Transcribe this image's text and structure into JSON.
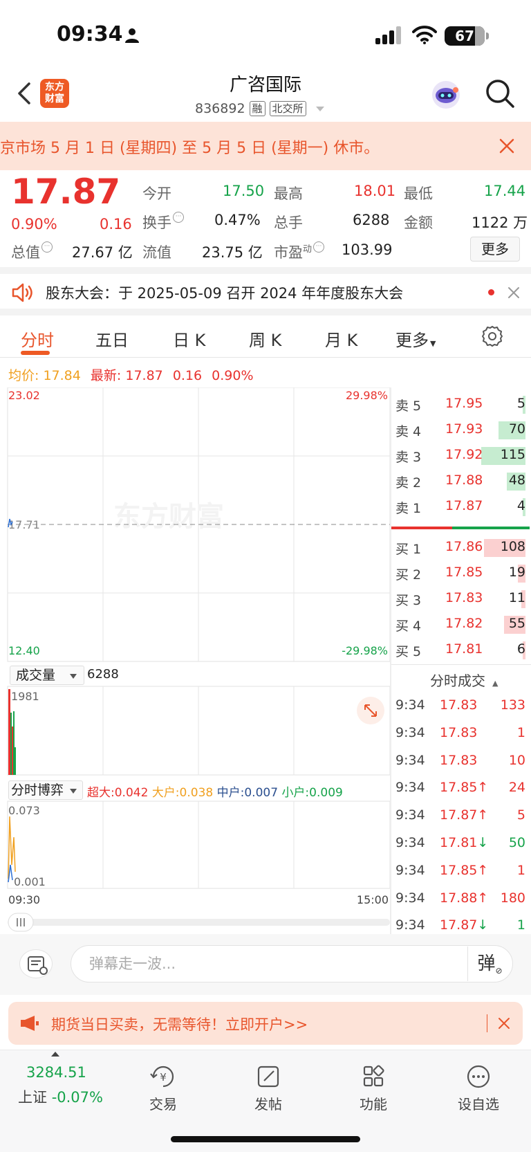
{
  "status_bar": {
    "time": "09:34",
    "battery": "67"
  },
  "header": {
    "title": "广咨国际",
    "code": "836892",
    "tag_margin": "融",
    "tag_exchange": "北交所",
    "logo_line1": "东方",
    "logo_line2": "财富"
  },
  "notice": {
    "text": "京市场 5 月 1 日 (星期四) 至 5 月 5 日 (星期一) 休市。"
  },
  "quote": {
    "price": "17.87",
    "change_pct": "0.90%",
    "change": "0.16",
    "open_label": "今开",
    "open": "17.50",
    "high_label": "最高",
    "high": "18.01",
    "low_label": "最低",
    "low": "17.44",
    "turnover_label": "换手",
    "turnover": "0.47%",
    "volume_label": "总手",
    "volume": "6288",
    "amount_label": "金额",
    "amount": "1122 万",
    "mktcap_label": "总值",
    "mktcap": "27.67 亿",
    "float_label": "流值",
    "float": "23.75 亿",
    "pe_label": "市盈",
    "pe_sup": "动",
    "pe": "103.99",
    "more": "更多"
  },
  "meeting": {
    "text": "股东大会：于 2025-05-09 召开 2024 年年度股东大会"
  },
  "tabs": [
    "分时",
    "五日",
    "日 K",
    "周 K",
    "月 K",
    "更多"
  ],
  "intraday": {
    "avg_label": "均价:",
    "avg": "17.84",
    "latest_label": "最新:",
    "latest": "17.87",
    "chg": "0.16",
    "pct": "0.90%",
    "ymax": "23.02",
    "ymin": "12.40",
    "pmax": "29.98%",
    "pmin": "-29.98%",
    "pre_close": "17.71",
    "watermark": "东方财富"
  },
  "orderbook": {
    "asks": [
      {
        "label": "卖 5",
        "price": "17.95",
        "vol": "5",
        "share": 0.03
      },
      {
        "label": "卖 4",
        "price": "17.93",
        "vol": "70",
        "share": 0.39
      },
      {
        "label": "卖 3",
        "price": "17.92",
        "vol": "115",
        "share": 0.64
      },
      {
        "label": "卖 2",
        "price": "17.88",
        "vol": "48",
        "share": 0.27
      },
      {
        "label": "卖 1",
        "price": "17.87",
        "vol": "4",
        "share": 0.02
      }
    ],
    "bids": [
      {
        "label": "买 1",
        "price": "17.86",
        "vol": "108",
        "share": 0.6
      },
      {
        "label": "买 2",
        "price": "17.85",
        "vol": "19",
        "share": 0.11
      },
      {
        "label": "买 3",
        "price": "17.83",
        "vol": "11",
        "share": 0.06
      },
      {
        "label": "买 4",
        "price": "17.82",
        "vol": "55",
        "share": 0.31
      },
      {
        "label": "买 5",
        "price": "17.81",
        "vol": "6",
        "share": 0.03
      }
    ]
  },
  "ticks": {
    "header": "分时成交",
    "rows": [
      {
        "time": "9:34",
        "price": "17.83",
        "arrow": "",
        "vol": "133",
        "dir": "up"
      },
      {
        "time": "9:34",
        "price": "17.83",
        "arrow": "",
        "vol": "1",
        "dir": "up"
      },
      {
        "time": "9:34",
        "price": "17.83",
        "arrow": "",
        "vol": "10",
        "dir": "up"
      },
      {
        "time": "9:34",
        "price": "17.85",
        "arrow": "↑",
        "vol": "24",
        "dir": "up"
      },
      {
        "time": "9:34",
        "price": "17.87",
        "arrow": "↑",
        "vol": "5",
        "dir": "up"
      },
      {
        "time": "9:34",
        "price": "17.81",
        "arrow": "↓",
        "vol": "50",
        "dir": "down"
      },
      {
        "time": "9:34",
        "price": "17.85",
        "arrow": "↑",
        "vol": "1",
        "dir": "up"
      },
      {
        "time": "9:34",
        "price": "17.88",
        "arrow": "↑",
        "vol": "180",
        "dir": "up"
      },
      {
        "time": "9:34",
        "price": "17.87",
        "arrow": "↓",
        "vol": "1",
        "dir": "down"
      }
    ]
  },
  "volume_panel": {
    "selector": "成交量",
    "total": "6288",
    "max": "1981"
  },
  "game_panel": {
    "selector": "分时博弈",
    "super_label": "超大:",
    "super": "0.042",
    "large_label": "大户:",
    "large": "0.038",
    "mid_label": "中户:",
    "mid": "0.007",
    "small_label": "小户:",
    "small": "0.009",
    "ymax": "0.073",
    "ymin": "0.001"
  },
  "time_axis": {
    "start": "09:30",
    "end": "15:00"
  },
  "comment": {
    "placeholder": "弹幕走一波...",
    "danmu": "弹"
  },
  "ad": {
    "text": "期货当日买卖，无需等待！立即开户>>"
  },
  "bottom_nav": {
    "index_value": "3284.51",
    "index_name": "上证",
    "index_chg": "-0.07%",
    "trade": "交易",
    "post": "发帖",
    "func": "功能",
    "watch": "设自选"
  },
  "colors": {
    "red": "#e8322e",
    "green": "#16a34a",
    "orange": "#ee5a24"
  }
}
